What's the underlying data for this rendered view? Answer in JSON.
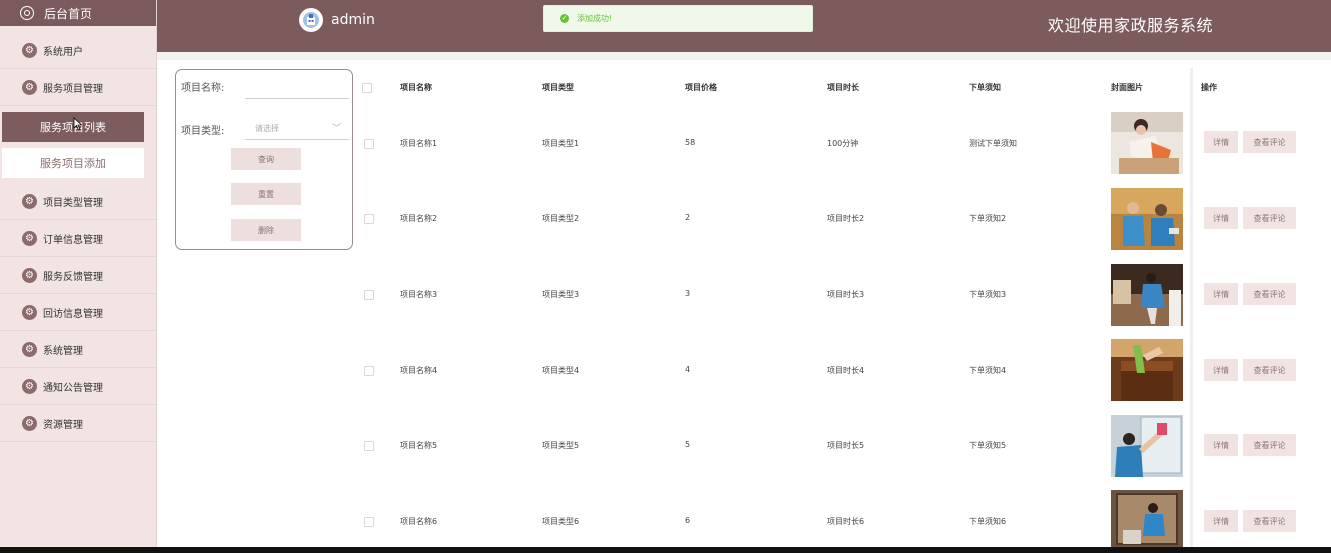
{
  "sidebar": {
    "home_label": "后台首页",
    "items_top": [
      {
        "label": "系统用户",
        "icon": "gear-icon"
      },
      {
        "label": "服务项目管理",
        "icon": "gear-icon"
      }
    ],
    "sub_active": "服务项目列表",
    "sub_item": "服务项目添加",
    "items_bottom": [
      {
        "label": "项目类型管理",
        "icon": "gear-icon"
      },
      {
        "label": "订单信息管理",
        "icon": "gear-icon"
      },
      {
        "label": "服务反馈管理",
        "icon": "gear-icon"
      },
      {
        "label": "回访信息管理",
        "icon": "gear-icon"
      },
      {
        "label": "系统管理",
        "icon": "gear-icon"
      },
      {
        "label": "通知公告管理",
        "icon": "gear-icon"
      },
      {
        "label": "资源管理",
        "icon": "gear-icon"
      }
    ]
  },
  "header": {
    "username": "admin",
    "welcome": "欢迎使用家政服务系统",
    "toast": "添加成功!"
  },
  "search": {
    "name_label": "项目名称:",
    "name_value": "",
    "type_label": "项目类型:",
    "type_placeholder": "请选择",
    "query_btn": "查询",
    "reset_btn": "重置",
    "delete_btn": "删除"
  },
  "table": {
    "headers": [
      "项目名称",
      "项目类型",
      "项目价格",
      "项目时长",
      "下单须知",
      "封面图片",
      "操作"
    ],
    "rows": [
      {
        "name": "项目名称1",
        "type": "项目类型1",
        "price": "58",
        "duration": "100分钟",
        "notice": "测试下单须知"
      },
      {
        "name": "项目名称2",
        "type": "项目类型2",
        "price": "2",
        "duration": "项目时长2",
        "notice": "下单须知2"
      },
      {
        "name": "项目名称3",
        "type": "项目类型3",
        "price": "3",
        "duration": "项目时长3",
        "notice": "下单须知3"
      },
      {
        "name": "项目名称4",
        "type": "项目类型4",
        "price": "4",
        "duration": "项目时长4",
        "notice": "下单须知4"
      },
      {
        "name": "项目名称5",
        "type": "项目类型5",
        "price": "5",
        "duration": "项目时长5",
        "notice": "下单须知5"
      },
      {
        "name": "项目名称6",
        "type": "项目类型6",
        "price": "6",
        "duration": "项目时长6",
        "notice": "下单须知6"
      }
    ],
    "detail_btn": "详情",
    "comment_btn": "查看评论"
  },
  "colors": {
    "brand": "#7c5b5d",
    "sidebar_bg": "#f1e4e3",
    "button_bg": "#f2e3e3",
    "success": "#67c23a"
  }
}
